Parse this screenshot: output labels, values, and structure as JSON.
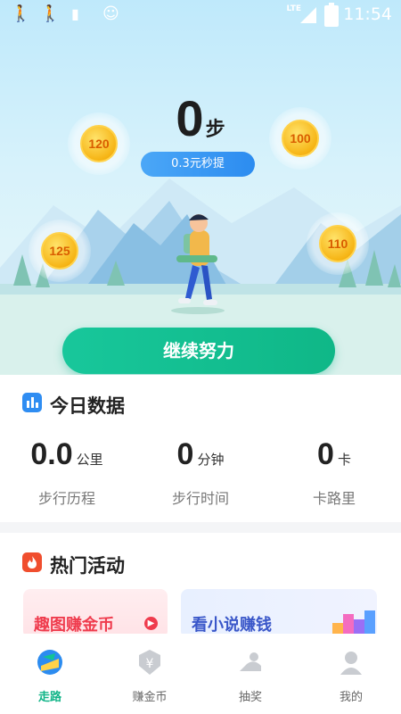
{
  "status_bar": {
    "time": "11:54",
    "network": "LTE"
  },
  "hero": {
    "steps_value": "0",
    "steps_unit": "步",
    "withdraw_label": "0.3元秒提",
    "coins": [
      "120",
      "100",
      "125",
      "110"
    ],
    "cta_label": "继续努力"
  },
  "today": {
    "title": "今日数据",
    "stats": [
      {
        "value": "0.0",
        "unit": "公里",
        "label": "步行历程"
      },
      {
        "value": "0",
        "unit": "分钟",
        "label": "步行时间"
      },
      {
        "value": "0",
        "unit": "卡",
        "label": "卡路里"
      }
    ]
  },
  "activities": {
    "title": "热门活动",
    "cards": [
      {
        "label": "趣图赚金币"
      },
      {
        "label": "看小说赚钱"
      }
    ]
  },
  "tabs": [
    {
      "label": "走路"
    },
    {
      "label": "赚金币"
    },
    {
      "label": "抽奖"
    },
    {
      "label": "我的"
    }
  ],
  "colors": {
    "accent": "#10b487",
    "withdraw": "#2c8cf0",
    "coin": "#f6b516"
  }
}
